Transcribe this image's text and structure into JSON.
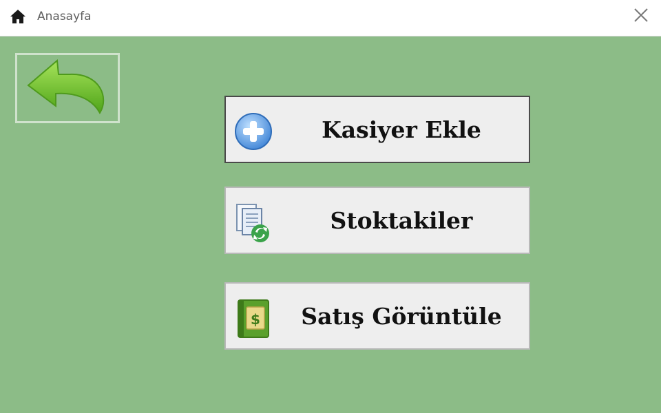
{
  "window": {
    "title": "Anasayfa",
    "title_icon": "home-icon",
    "close_icon": "close-icon"
  },
  "colors": {
    "background": "#8cbc87",
    "button_face": "#eeeeee",
    "back_arrow": "#7ccf2e"
  },
  "back_button": {
    "icon": "back-arrow-icon"
  },
  "menu": [
    {
      "label": "Kasiyer Ekle",
      "icon": "add-circle-icon"
    },
    {
      "label": "Stoktakiler",
      "icon": "document-refresh-icon"
    },
    {
      "label": "Satış Görüntüle",
      "icon": "money-book-icon"
    }
  ]
}
